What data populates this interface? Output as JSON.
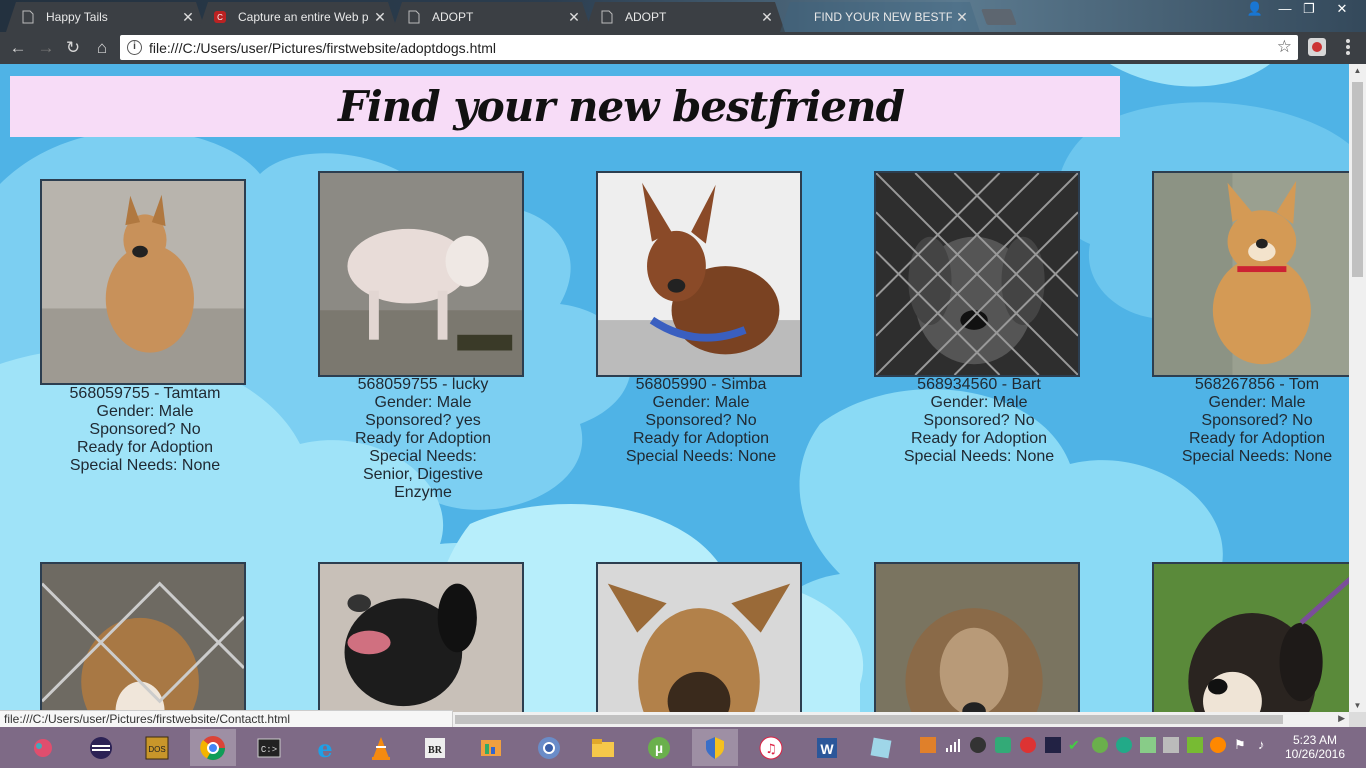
{
  "browser": {
    "tabs": [
      {
        "title": "Happy Tails",
        "active": false
      },
      {
        "title": "Capture an entire Web p",
        "active": false
      },
      {
        "title": "ADOPT",
        "active": false
      },
      {
        "title": "ADOPT",
        "active": false
      },
      {
        "title": "FIND YOUR NEW BESTF",
        "active": true
      }
    ],
    "url": "file:///C:/Users/user/Pictures/firstwebsite/adoptdogs.html",
    "status_url": "file:///C:/Users/user/Pictures/firstwebsite/Contactt.html"
  },
  "page": {
    "heading": "Find your new bestfriend",
    "dogs": [
      {
        "name": "568059755 - Tamtam",
        "gender": "Gender: Male",
        "sponsored": "Sponsored? No",
        "status": "Ready for Adoption",
        "needs": "Special Needs: None",
        "coat": "#c8915a"
      },
      {
        "name": "568059755 - lucky",
        "gender": "Gender: Male",
        "sponsored": "Sponsored? yes",
        "status": "Ready for Adoption",
        "needs": "Special Needs: Senior, Digestive Enzyme",
        "coat": "#e8dcd8"
      },
      {
        "name": "56805990 - Simba",
        "gender": "Gender: Male",
        "sponsored": "Sponsored? No",
        "status": "Ready for Adoption",
        "needs": "Special Needs: None",
        "coat": "#8a4a28"
      },
      {
        "name": "568934560 - Bart",
        "gender": "Gender: Male",
        "sponsored": "Sponsored? No",
        "status": "Ready for Adoption",
        "needs": "Special Needs: None",
        "coat": "#555555"
      },
      {
        "name": "568267856 - Tom",
        "gender": "Gender: Male",
        "sponsored": "Sponsored? No",
        "status": "Ready for Adoption",
        "needs": "Special Needs: None",
        "coat": "#d49a55"
      }
    ],
    "row2_coats": [
      "#a87844",
      "#1c1c1c",
      "#b2814a",
      "#8a6a48",
      "#2a2420"
    ]
  },
  "taskbar": {
    "time": "5:23 AM",
    "date": "10/26/2016"
  },
  "colors": {
    "header_band": "#f7dcf7",
    "sky": "#4fb3e6",
    "taskbar": "#7e6a86"
  }
}
